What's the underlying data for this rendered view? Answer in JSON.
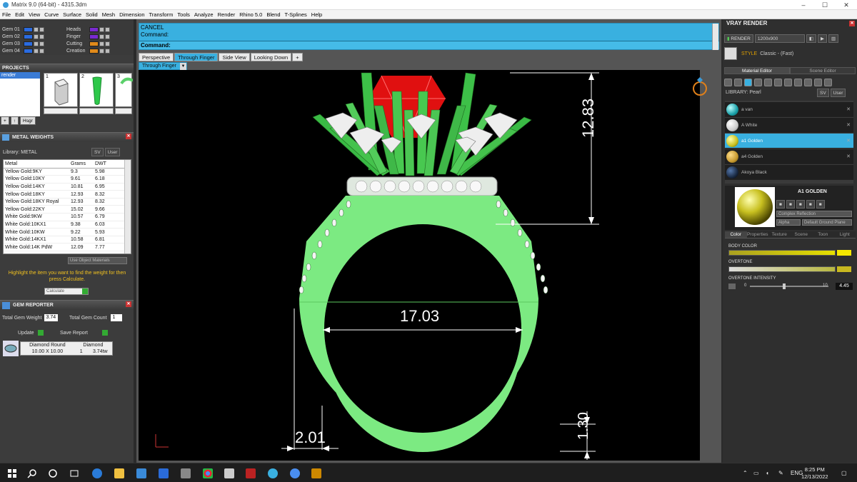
{
  "window": {
    "title": "Matrix 9.0 (64-bit) - 4315.3dm",
    "min": "–",
    "max": "☐",
    "close": "✕"
  },
  "menu": [
    "File",
    "Edit",
    "View",
    "Curve",
    "Surface",
    "Solid",
    "Mesh",
    "Dimension",
    "Transform",
    "Tools",
    "Analyze",
    "Render",
    "Rhino 5.0",
    "Blend",
    "T-Splines",
    "Help"
  ],
  "gems": [
    {
      "label": "Gem 01",
      "color": "#2a6be0"
    },
    {
      "label": "Gem 02",
      "color": "#2a6be0"
    },
    {
      "label": "Gem 03",
      "color": "#2a6be0"
    },
    {
      "label": "Gem 04",
      "color": "#2a6be0"
    }
  ],
  "layers": [
    {
      "label": "Heads",
      "color": "#7a2ad0"
    },
    {
      "label": "Finger",
      "color": "#7a2ad0"
    },
    {
      "label": "Cutting",
      "color": "#e08a1a"
    },
    {
      "label": "Creation",
      "color": "#e08a1a"
    }
  ],
  "projects": {
    "title": "PROJECTS",
    "items": [
      "render"
    ],
    "thumb_numbers": [
      "1",
      "2",
      "3"
    ],
    "buttons": [
      "+",
      "↑",
      "Hsgr"
    ]
  },
  "metal": {
    "title": "METAL WEIGHTS",
    "library": "Library: METAL",
    "lib_mode": "SV",
    "lib_user": "User",
    "headers": [
      "Metal",
      "Grams",
      "DWT"
    ],
    "rows": [
      [
        "Yellow Gold:9KY",
        "9.3",
        "5.98"
      ],
      [
        "Yellow Gold:10KY",
        "9.61",
        "6.18"
      ],
      [
        "Yellow Gold:14KY",
        "10.81",
        "6.95"
      ],
      [
        "Yellow Gold:18KY",
        "12.93",
        "8.32"
      ],
      [
        "Yellow Gold:18KY Royal",
        "12.93",
        "8.32"
      ],
      [
        "Yellow Gold:22KY",
        "15.02",
        "9.66"
      ],
      [
        "White Gold:9KW",
        "10.57",
        "6.79"
      ],
      [
        "White Gold:10KX1",
        "9.38",
        "6.03"
      ],
      [
        "White Gold:10KW",
        "9.22",
        "5.93"
      ],
      [
        "White Gold:14KX1",
        "10.58",
        "6.81"
      ],
      [
        "White Gold:14K PdW",
        "12.09",
        "7.77"
      ]
    ],
    "use_object": "Use Object Materials",
    "highlight": "Highlight the item you want to find the weight for then press Calculate.",
    "calculate": "Calculate"
  },
  "gem_reporter": {
    "title": "GEM REPORTER",
    "total_weight_label": "Total Gem Weight",
    "total_weight": "3.74",
    "total_count_label": "Total Gem Count",
    "total_count": "1",
    "update": "Update",
    "save": "Save Report",
    "table_headers": [
      "Diamond Round",
      "Diamond"
    ],
    "table_row": [
      "10.00 X 10.00",
      "1",
      "3.74tw"
    ]
  },
  "command": {
    "line1": "CANCEL",
    "line2": "Command:",
    "prompt": "Command:"
  },
  "tabs": [
    "Perspective",
    "Through Finger",
    "Side View",
    "Looking Down",
    "+"
  ],
  "active_tab": "Through Finger",
  "viewport_label": "Through Finger",
  "dims": {
    "height": "12.83",
    "inner": "17.03",
    "shank": "2.01",
    "base": "1.30"
  },
  "vray": {
    "title": "VRAY RENDER",
    "render": "RENDER",
    "size": "1200x900",
    "style_label": "STYLE",
    "style_value": "Classic - (Fast)",
    "tabs": [
      "Material Editor",
      "Scene Editor"
    ],
    "library": "LIBRARY: Pearl",
    "lib_mode": "SV",
    "lib_user": "User",
    "materials": [
      {
        "name": "a van",
        "color": "#1aa0a8"
      },
      {
        "name": "A White",
        "color": "#d8d8d8"
      },
      {
        "name": "a1 Golden",
        "color": "#c8c020"
      },
      {
        "name": "a4 Golden",
        "color": "#c89a30"
      },
      {
        "name": "Akoya Black",
        "color": "#1a2a44"
      }
    ],
    "selected_material": "A1 GOLDEN",
    "reflection": "Complex Reflection",
    "alpha": "Alpha",
    "ground": "Default Ground Plane",
    "prop_tabs": [
      "Color",
      "Properties",
      "Texture",
      "Scene",
      "Toon",
      "Light"
    ],
    "body_color": "BODY COLOR",
    "overtone": "OVERTONE",
    "overtone_intensity": "OVERTONE INTENSITY",
    "intensity_min": "0",
    "intensity_max": "10",
    "intensity_value": "4.45",
    "accent": "#39b0e0"
  },
  "taskbar": {
    "lang": "ENG",
    "time": "8:25 PM",
    "date": "12/13/2022"
  }
}
